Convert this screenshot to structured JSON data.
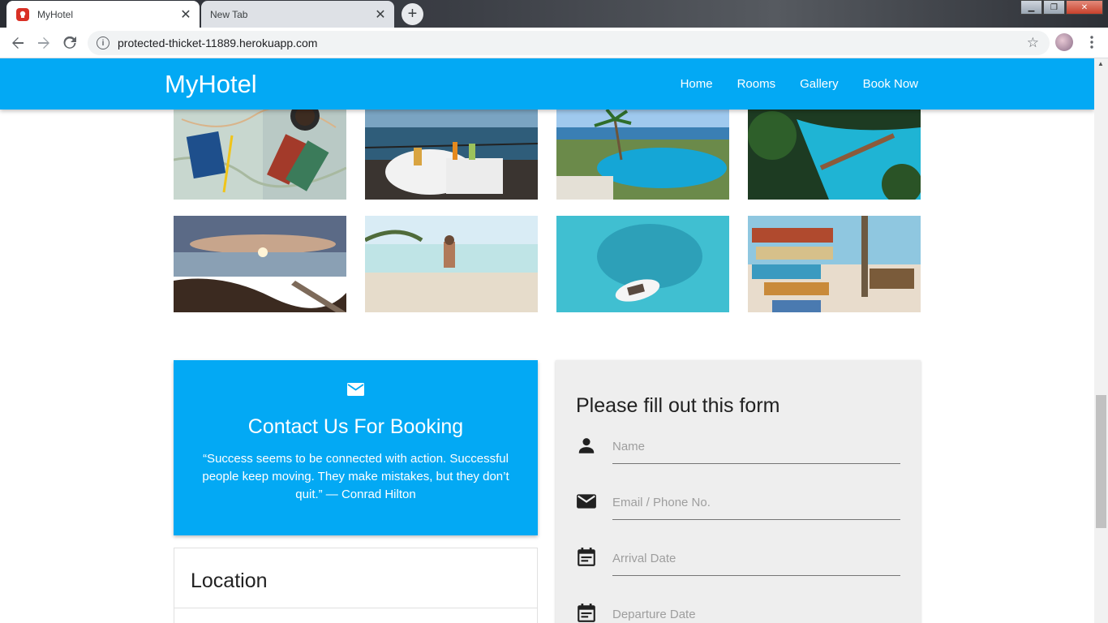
{
  "browser": {
    "tabs": [
      {
        "label": "MyHotel",
        "active": true
      },
      {
        "label": "New Tab",
        "active": false
      }
    ],
    "close_glyph": "✕",
    "new_tab_glyph": "+",
    "url": "protected-thicket-11889.herokuapp.com",
    "info_glyph": "i",
    "star_glyph": "☆",
    "menu_glyph": "⋮"
  },
  "navbar": {
    "brand": "MyHotel",
    "links": [
      "Home",
      "Rooms",
      "Gallery",
      "Book Now"
    ],
    "color": "#03a9f4"
  },
  "gallery": {
    "photos": [
      "map-coffee",
      "balcony-breakfast",
      "pool-palm",
      "lagoon-bridge",
      "sunset-rocks",
      "beach-swimmer",
      "boat-aerial",
      "beach-signs"
    ]
  },
  "contact": {
    "icon": "mail-icon",
    "title": "Contact Us For Booking",
    "quote": "“Success seems to be connected with action. Successful people keep moving. They make mistakes, but they don’t quit.” — Conrad Hilton"
  },
  "location": {
    "title": "Location"
  },
  "form": {
    "title": "Please fill out this form",
    "fields": [
      {
        "icon": "person-icon",
        "placeholder": "Name"
      },
      {
        "icon": "email-icon",
        "placeholder": "Email / Phone No."
      },
      {
        "icon": "calendar-icon",
        "placeholder": "Arrival Date"
      },
      {
        "icon": "calendar-icon",
        "placeholder": "Departure Date"
      }
    ]
  }
}
